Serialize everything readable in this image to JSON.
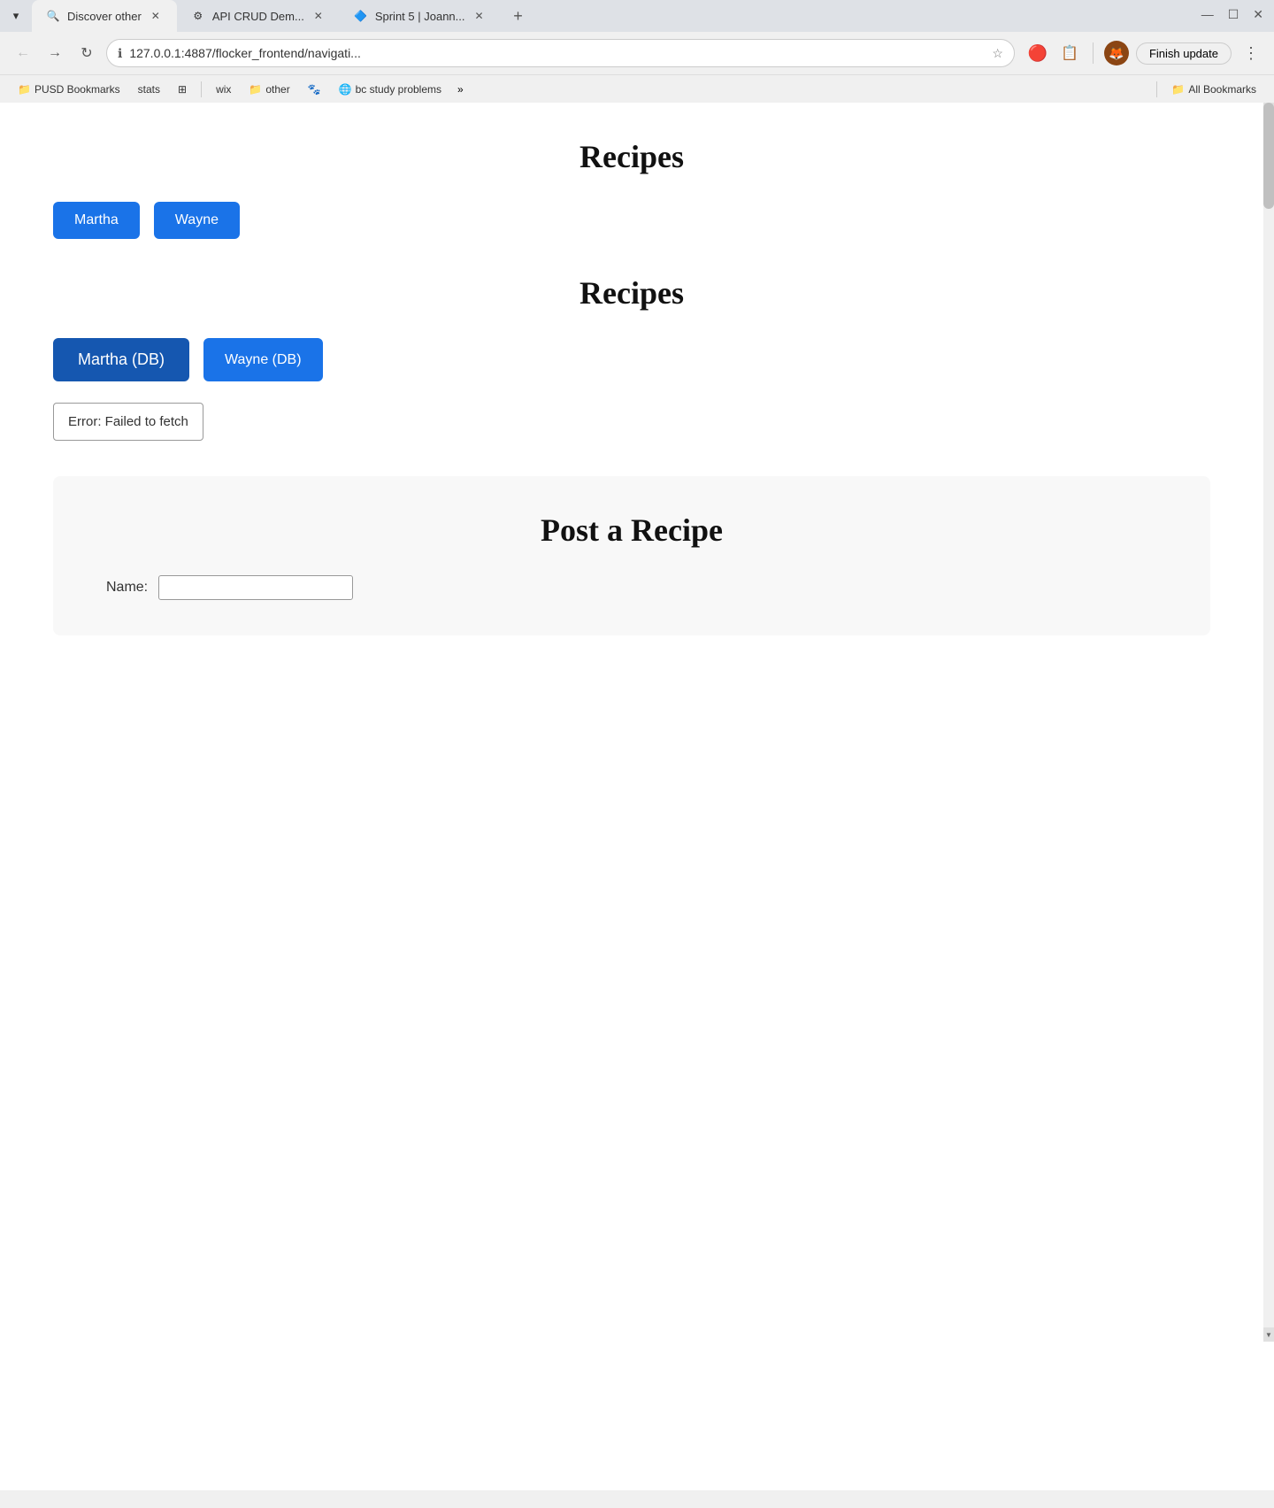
{
  "browser": {
    "tabs": [
      {
        "id": "tab1",
        "title": "Discover other",
        "favicon": "🔍",
        "active": true
      },
      {
        "id": "tab2",
        "title": "API CRUD Dem...",
        "favicon": "⚙",
        "active": false
      },
      {
        "id": "tab3",
        "title": "Sprint 5 | Joann...",
        "favicon": "🔷",
        "active": false
      }
    ],
    "new_tab_label": "+",
    "window_controls": {
      "minimize": "—",
      "maximize": "☐",
      "close": "✕"
    },
    "address_bar": {
      "url": "127.0.0.1:4887/flocker_frontend/navigati...",
      "info_icon": "ℹ",
      "star_icon": "☆"
    },
    "toolbar": {
      "back_label": "←",
      "forward_label": "→",
      "refresh_label": "↻",
      "extension1_label": "🔴",
      "extension2_label": "📋",
      "avatar_label": "🦊",
      "finish_update": "Finish update",
      "kebab_label": "⋮"
    },
    "bookmarks": {
      "items": [
        {
          "label": "PUSD Bookmarks",
          "icon": "📁"
        },
        {
          "label": "stats",
          "icon": ""
        },
        {
          "label": "⊞",
          "icon": ""
        },
        {
          "label": "wix",
          "icon": ""
        },
        {
          "label": "other",
          "icon": "📁"
        },
        {
          "label": "🐾",
          "icon": ""
        },
        {
          "label": "bc study problems",
          "icon": "🌐"
        }
      ],
      "more_label": "»",
      "all_bookmarks_label": "All Bookmarks",
      "all_bookmarks_icon": "📁"
    }
  },
  "page": {
    "section1": {
      "title": "Recipes",
      "buttons": [
        {
          "label": "Martha"
        },
        {
          "label": "Wayne"
        }
      ]
    },
    "section2": {
      "title": "Recipes",
      "buttons": [
        {
          "label": "Martha (DB)"
        },
        {
          "label": "Wayne (DB)"
        }
      ],
      "error": "Error: Failed to fetch"
    },
    "post_section": {
      "title": "Post a Recipe",
      "form": {
        "name_label": "Name:",
        "name_placeholder": ""
      }
    }
  }
}
